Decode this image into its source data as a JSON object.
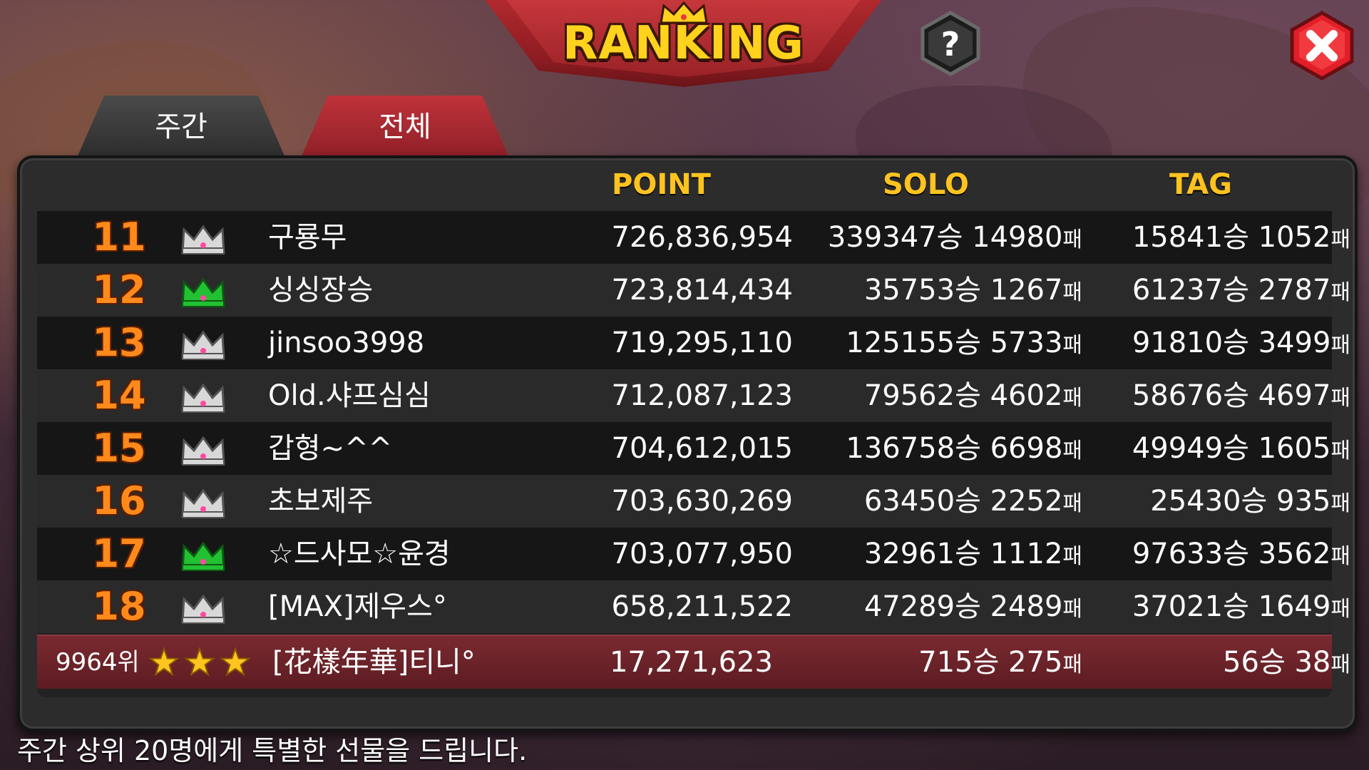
{
  "header": {
    "title": "RANKING",
    "help_label": "?",
    "close_icon": "close-x-icon"
  },
  "tabs": [
    {
      "label": "주간",
      "active": true
    },
    {
      "label": "전체",
      "active": false
    }
  ],
  "columns": {
    "point": "POINT",
    "solo": "SOLO",
    "tag": "TAG"
  },
  "colors": {
    "accent": "#ffc320",
    "rank": "#ff8a1c",
    "green_crown": "#22c032",
    "silver_crown": "#d8d8d8",
    "tab_active": "#4a4a4a",
    "tab_inactive": "#c0323a"
  },
  "rows": [
    {
      "rank": "11",
      "crown": "silver",
      "name": "구룡무",
      "point": "726,836,954",
      "solo_win": "339347",
      "solo_loss": "14980",
      "tag_win": "15841",
      "tag_loss": "1052"
    },
    {
      "rank": "12",
      "crown": "green",
      "name": "싱싱장승",
      "point": "723,814,434",
      "solo_win": "35753",
      "solo_loss": "1267",
      "tag_win": "61237",
      "tag_loss": "2787"
    },
    {
      "rank": "13",
      "crown": "silver",
      "name": "jinsoo3998",
      "point": "719,295,110",
      "solo_win": "125155",
      "solo_loss": "5733",
      "tag_win": "91810",
      "tag_loss": "3499"
    },
    {
      "rank": "14",
      "crown": "silver",
      "name": "Old.샤프심심",
      "point": "712,087,123",
      "solo_win": "79562",
      "solo_loss": "4602",
      "tag_win": "58676",
      "tag_loss": "4697"
    },
    {
      "rank": "15",
      "crown": "silver",
      "name": "갑형~^^",
      "point": "704,612,015",
      "solo_win": "136758",
      "solo_loss": "6698",
      "tag_win": "49949",
      "tag_loss": "1605"
    },
    {
      "rank": "16",
      "crown": "silver",
      "name": "초보제주",
      "point": "703,630,269",
      "solo_win": "63450",
      "solo_loss": "2252",
      "tag_win": "25430",
      "tag_loss": "935"
    },
    {
      "rank": "17",
      "crown": "green",
      "name": "☆드사모☆윤경",
      "point": "703,077,950",
      "solo_win": "32961",
      "solo_loss": "1112",
      "tag_win": "97633",
      "tag_loss": "3562"
    },
    {
      "rank": "18",
      "crown": "silver",
      "name": "[MAX]제우스°",
      "point": "658,211,522",
      "solo_win": "47289",
      "solo_loss": "2489",
      "tag_win": "37021",
      "tag_loss": "1649"
    }
  ],
  "my_row": {
    "rank": "9964위",
    "stars": 3,
    "name": "[花樣年華]티니°",
    "point": "17,271,623",
    "solo_win": "715",
    "solo_loss": "275",
    "tag_win": "56",
    "tag_loss": "38"
  },
  "units": {
    "win": "승",
    "loss": "패"
  },
  "footer": "주간 상위 20명에게 특별한 선물을 드립니다."
}
